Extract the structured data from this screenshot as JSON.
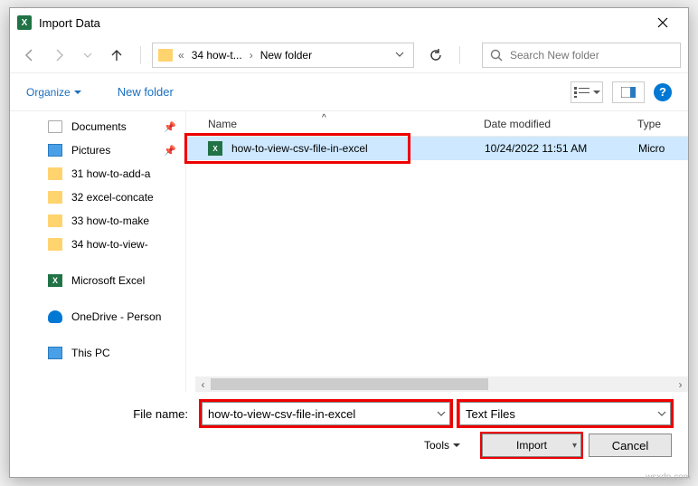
{
  "window": {
    "title": "Import Data"
  },
  "nav": {
    "breadcrumb": {
      "parent": "34 how-t...",
      "current": "New folder"
    },
    "search_placeholder": "Search New folder"
  },
  "toolbar": {
    "organize": "Organize",
    "newfolder": "New folder",
    "help": "?"
  },
  "sidebar": {
    "items": [
      {
        "label": "Documents",
        "pinned": true
      },
      {
        "label": "Pictures",
        "pinned": true
      },
      {
        "label": "31 how-to-add-a"
      },
      {
        "label": "32 excel-concate"
      },
      {
        "label": "33 how-to-make"
      },
      {
        "label": "34 how-to-view-"
      },
      {
        "label": "Microsoft Excel"
      },
      {
        "label": "OneDrive - Person"
      },
      {
        "label": "This PC"
      }
    ]
  },
  "cols": {
    "name": "Name",
    "date": "Date modified",
    "type": "Type"
  },
  "files": [
    {
      "name": "how-to-view-csv-file-in-excel",
      "date": "10/24/2022 11:51 AM",
      "type": "Micro"
    }
  ],
  "footer": {
    "filename_label": "File name:",
    "filename_value": "how-to-view-csv-file-in-excel",
    "filter": "Text Files",
    "tools": "Tools",
    "import": "Import",
    "cancel": "Cancel"
  },
  "watermark": "wsxdn.com"
}
